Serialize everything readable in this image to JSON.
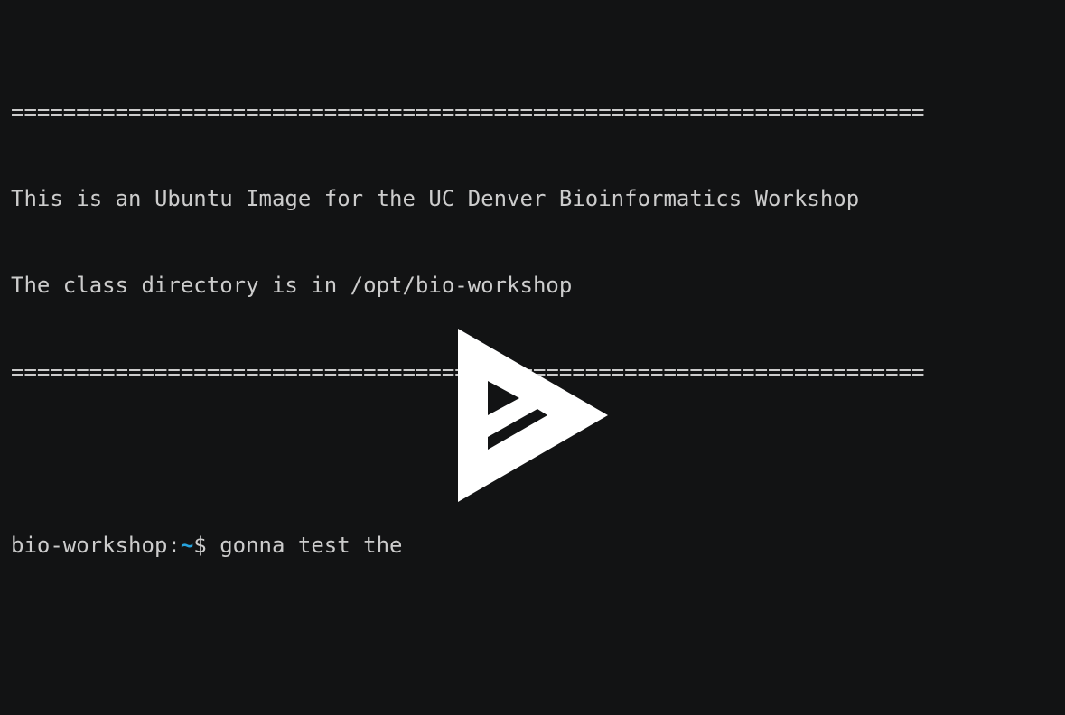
{
  "terminal": {
    "banner_rule_top": "======================================================================",
    "banner_line_1": "This is an Ubuntu Image for the UC Denver Bioinformatics Workshop",
    "banner_line_2": "The class directory is in /opt/bio-workshop",
    "banner_rule_bottom": "======================================================================",
    "prompt_host": "bio-workshop:",
    "prompt_path": "~",
    "prompt_symbol": "$ ",
    "command_text": "gonna test the"
  },
  "overlay": {
    "icon": "asciinema-play-icon",
    "color": "#ffffff"
  },
  "colors": {
    "background": "#121314",
    "foreground": "#cccccc",
    "prompt_path": "#26a3dd"
  }
}
